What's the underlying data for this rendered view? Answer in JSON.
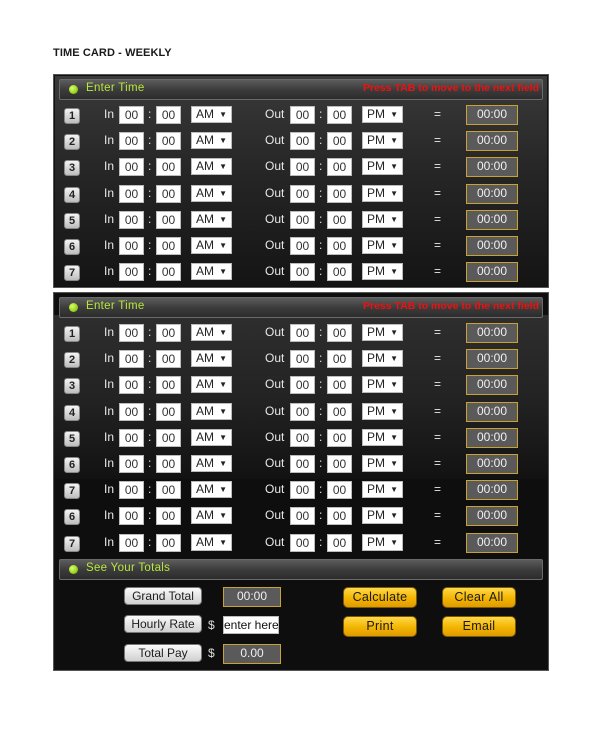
{
  "page_title": "TIME CARD - WEEKLY",
  "section_bar_enter": {
    "label": "Enter Time",
    "hint": "Press TAB to move to the next field",
    "indicator_color": "#9ad21c",
    "hint_color": "#ee1111"
  },
  "labels": {
    "in": "In",
    "out": "Out",
    "colon": ":",
    "equals": "=",
    "dropdown_arrow": "▼"
  },
  "panel1": {
    "rows": [
      {
        "num": "1",
        "in_h": "00",
        "in_m": "00",
        "in_ampm": "AM",
        "out_h": "00",
        "out_m": "00",
        "out_ampm": "PM",
        "result": "00:00"
      },
      {
        "num": "2",
        "in_h": "00",
        "in_m": "00",
        "in_ampm": "AM",
        "out_h": "00",
        "out_m": "00",
        "out_ampm": "PM",
        "result": "00:00"
      },
      {
        "num": "3",
        "in_h": "00",
        "in_m": "00",
        "in_ampm": "AM",
        "out_h": "00",
        "out_m": "00",
        "out_ampm": "PM",
        "result": "00:00"
      },
      {
        "num": "4",
        "in_h": "00",
        "in_m": "00",
        "in_ampm": "AM",
        "out_h": "00",
        "out_m": "00",
        "out_ampm": "PM",
        "result": "00:00"
      },
      {
        "num": "5",
        "in_h": "00",
        "in_m": "00",
        "in_ampm": "AM",
        "out_h": "00",
        "out_m": "00",
        "out_ampm": "PM",
        "result": "00:00"
      },
      {
        "num": "6",
        "in_h": "00",
        "in_m": "00",
        "in_ampm": "AM",
        "out_h": "00",
        "out_m": "00",
        "out_ampm": "PM",
        "result": "00:00"
      },
      {
        "num": "7",
        "in_h": "00",
        "in_m": "00",
        "in_ampm": "AM",
        "out_h": "00",
        "out_m": "00",
        "out_ampm": "PM",
        "result": "00:00"
      }
    ]
  },
  "panel2": {
    "rows": [
      {
        "num": "1",
        "in_h": "00",
        "in_m": "00",
        "in_ampm": "AM",
        "out_h": "00",
        "out_m": "00",
        "out_ampm": "PM",
        "result": "00:00"
      },
      {
        "num": "2",
        "in_h": "00",
        "in_m": "00",
        "in_ampm": "AM",
        "out_h": "00",
        "out_m": "00",
        "out_ampm": "PM",
        "result": "00:00"
      },
      {
        "num": "3",
        "in_h": "00",
        "in_m": "00",
        "in_ampm": "AM",
        "out_h": "00",
        "out_m": "00",
        "out_ampm": "PM",
        "result": "00:00"
      },
      {
        "num": "4",
        "in_h": "00",
        "in_m": "00",
        "in_ampm": "AM",
        "out_h": "00",
        "out_m": "00",
        "out_ampm": "PM",
        "result": "00:00"
      },
      {
        "num": "5",
        "in_h": "00",
        "in_m": "00",
        "in_ampm": "AM",
        "out_h": "00",
        "out_m": "00",
        "out_ampm": "PM",
        "result": "00:00"
      },
      {
        "num": "6",
        "in_h": "00",
        "in_m": "00",
        "in_ampm": "AM",
        "out_h": "00",
        "out_m": "00",
        "out_ampm": "PM",
        "result": "00:00"
      },
      {
        "num": "7",
        "in_h": "00",
        "in_m": "00",
        "in_ampm": "AM",
        "out_h": "00",
        "out_m": "00",
        "out_ampm": "PM",
        "result": "00:00"
      },
      {
        "num": "6",
        "in_h": "00",
        "in_m": "00",
        "in_ampm": "AM",
        "out_h": "00",
        "out_m": "00",
        "out_ampm": "PM",
        "result": "00:00"
      },
      {
        "num": "7",
        "in_h": "00",
        "in_m": "00",
        "in_ampm": "AM",
        "out_h": "00",
        "out_m": "00",
        "out_ampm": "PM",
        "result": "00:00"
      }
    ]
  },
  "totals": {
    "section_label": "See Your Totals",
    "grand_total_label": "Grand Total",
    "grand_total_value": "00:00",
    "hourly_rate_label": "Hourly Rate",
    "hourly_rate_value": "enter here",
    "total_pay_label": "Total Pay",
    "total_pay_value": "0.00",
    "currency": "$",
    "buttons": {
      "calculate": "Calculate",
      "clear_all": "Clear All",
      "print": "Print",
      "email": "Email"
    },
    "button_color": "#f2b400"
  }
}
